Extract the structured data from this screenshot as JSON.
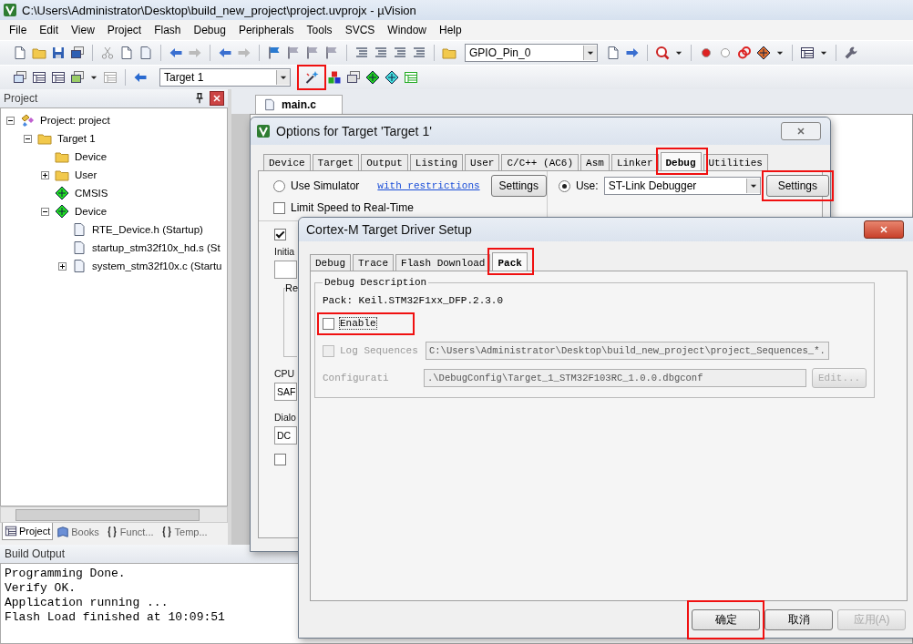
{
  "window": {
    "title": "C:\\Users\\Administrator\\Desktop\\build_new_project\\project.uvprojx - µVision"
  },
  "menu": [
    "File",
    "Edit",
    "View",
    "Project",
    "Flash",
    "Debug",
    "Peripherals",
    "Tools",
    "SVCS",
    "Window",
    "Help"
  ],
  "toolbar_1": {
    "combo": "GPIO_Pin_0"
  },
  "toolbar_2": {
    "target": "Target 1",
    "options_button_highlighted": true
  },
  "project_panel": {
    "title": "Project",
    "tree": [
      {
        "kind": "project",
        "label": "Project: project",
        "expanded": true,
        "children": [
          {
            "kind": "target",
            "label": "Target 1",
            "expanded": true,
            "children": [
              {
                "kind": "folder",
                "label": "Device"
              },
              {
                "kind": "folder",
                "label": "User",
                "expanded": false
              },
              {
                "kind": "component",
                "label": "CMSIS"
              },
              {
                "kind": "component",
                "label": "Device",
                "expanded": true,
                "children": [
                  {
                    "kind": "file",
                    "label": "RTE_Device.h (Startup)"
                  },
                  {
                    "kind": "file",
                    "label": "startup_stm32f10x_hd.s (St"
                  },
                  {
                    "kind": "file",
                    "label": "system_stm32f10x.c (Startu",
                    "expanded": false
                  }
                ]
              }
            ]
          }
        ]
      }
    ],
    "tabs": [
      {
        "label": "Project",
        "selected": true
      },
      {
        "label": "Books",
        "selected": false
      },
      {
        "label": "Funct...",
        "selected": false
      },
      {
        "label": "Temp...",
        "selected": false
      }
    ]
  },
  "editor": {
    "tabs": [
      {
        "label": "main.c",
        "selected": true
      }
    ]
  },
  "build_output": {
    "title": "Build Output",
    "lines": [
      "Programming Done.",
      "Verify OK.",
      "Application running ...",
      "Flash Load finished at 10:09:51"
    ]
  },
  "options_dialog": {
    "title": "Options for Target 'Target 1'",
    "tabs": [
      {
        "label": "Device",
        "selected": false,
        "highlighted": false
      },
      {
        "label": "Target",
        "selected": false,
        "highlighted": false
      },
      {
        "label": "Output",
        "selected": false,
        "highlighted": false
      },
      {
        "label": "Listing",
        "selected": false,
        "highlighted": false
      },
      {
        "label": "User",
        "selected": false,
        "highlighted": false
      },
      {
        "label": "C/C++ (AC6)",
        "selected": false,
        "highlighted": false
      },
      {
        "label": "Asm",
        "selected": false,
        "highlighted": false
      },
      {
        "label": "Linker",
        "selected": false,
        "highlighted": false
      },
      {
        "label": "Debug",
        "selected": true,
        "highlighted": true
      },
      {
        "label": "Utilities",
        "selected": false,
        "highlighted": false
      }
    ],
    "use_simulator": {
      "label": "Use Simulator",
      "selected": false
    },
    "restrictions_link": "with restrictions",
    "simulator_settings": "Settings",
    "limit_speed": {
      "label": "Limit Speed to Real-Time",
      "checked": false
    },
    "use_debugger": {
      "label": "Use:",
      "selected": true
    },
    "debugger": "ST-Link Debugger",
    "debugger_settings": {
      "label": "Settings",
      "highlighted": true
    },
    "load_checkbox": {
      "checked": true
    },
    "init_label": "Initia",
    "restore_group": "Re",
    "cpu_label": "CPU",
    "cpu_field": "SAF",
    "dialog_label": "Dialo",
    "dialog_field": "DC",
    "last_checkbox": {
      "checked": false
    }
  },
  "cortex_dialog": {
    "title": "Cortex-M Target Driver Setup",
    "tabs": [
      {
        "label": "Debug",
        "selected": false,
        "highlighted": false
      },
      {
        "label": "Trace",
        "selected": false,
        "highlighted": false
      },
      {
        "label": "Flash Download",
        "selected": false,
        "highlighted": false
      },
      {
        "label": "Pack",
        "selected": true,
        "highlighted": true
      }
    ],
    "group": "Debug Description",
    "pack": "Pack: Keil.STM32F1xx_DFP.2.3.0",
    "enable": {
      "label": "Enable",
      "checked": false,
      "highlighted": true
    },
    "log_sequences": {
      "label": "Log Sequences",
      "checked": false,
      "disabled": true
    },
    "log_path": "C:\\Users\\Administrator\\Desktop\\build_new_project\\project_Sequences_*.",
    "config_label": "Configurati",
    "config_path": ".\\DebugConfig\\Target_1_STM32F103RC_1.0.0.dbgconf",
    "edit_button": {
      "label": "Edit...",
      "disabled": true
    },
    "buttons": [
      {
        "label": "确定",
        "highlighted": true,
        "disabled": false
      },
      {
        "label": "取消",
        "highlighted": false,
        "disabled": false
      },
      {
        "label": "应用(A)",
        "highlighted": false,
        "disabled": true
      }
    ]
  }
}
